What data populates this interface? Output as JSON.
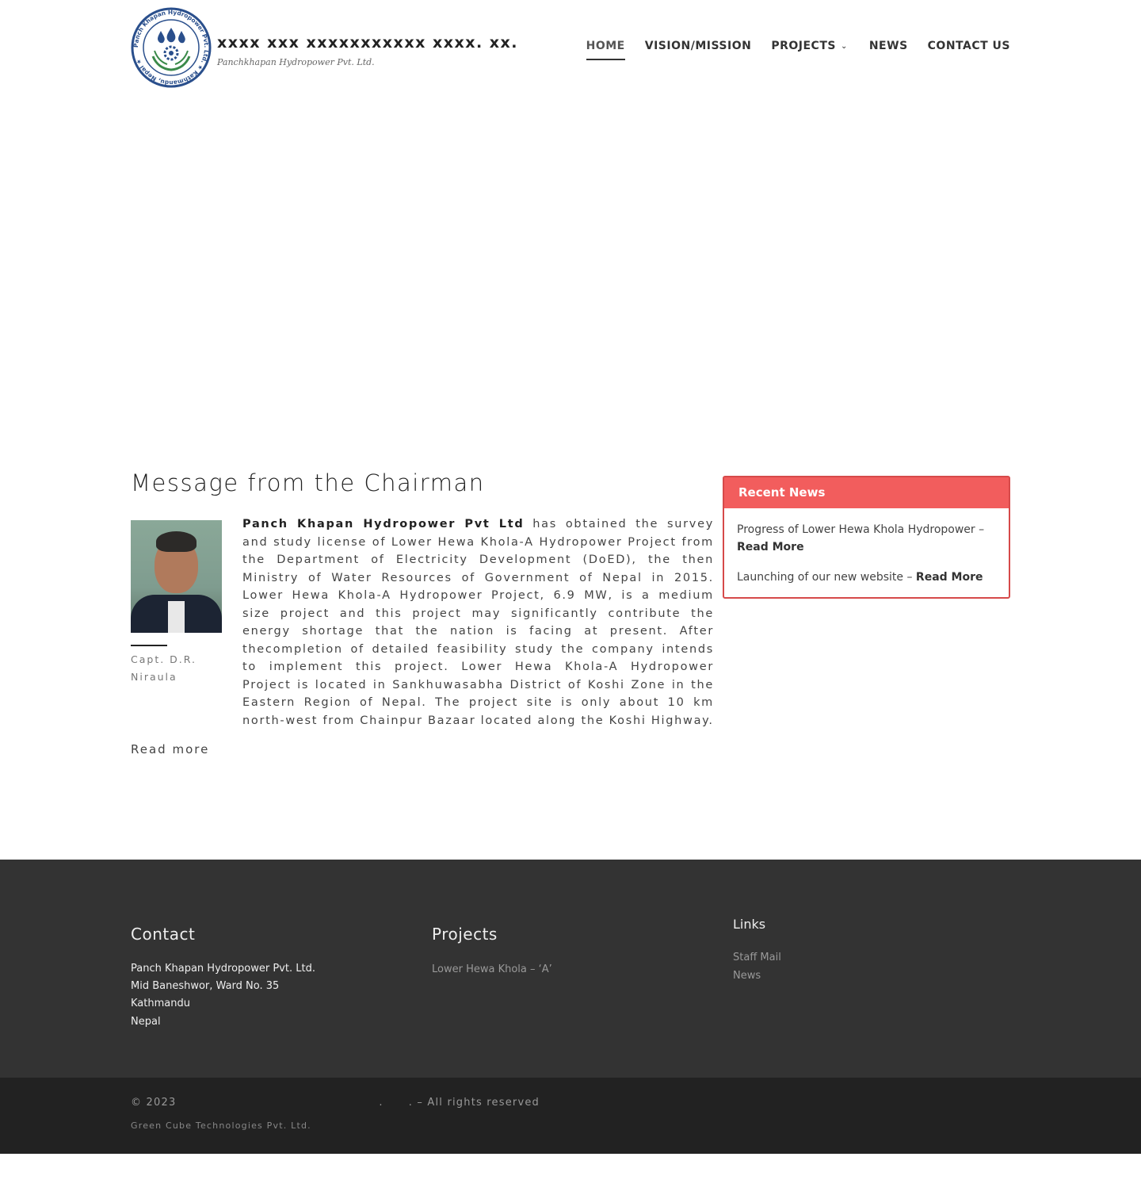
{
  "header": {
    "site_title": "xxxx xxx xxxxxxxxxxx xxxx. xx.",
    "tagline": "Panchkhapan Hydropower Pvt. Ltd.",
    "logo_text": "Panch Khapan Hydropower Pvt. Ltd. ★ Kathmandu, Nepal ★",
    "nav": [
      {
        "label": "HOME",
        "active": true
      },
      {
        "label": "VISION/MISSION"
      },
      {
        "label": "PROJECTS",
        "has_dropdown": true
      },
      {
        "label": "NEWS"
      },
      {
        "label": "CONTACT US"
      }
    ]
  },
  "chairman": {
    "heading": "Message from the Chairman",
    "name": "Capt. D.R. Niraula",
    "company_bold": "Panch Khapan Hydropower Pvt Ltd",
    "message": " has obtained the survey and study license of Lower Hewa Khola-A Hydropower Project from the Department of Electricity Development (DoED), the then Ministry of Water Resources of Government of Nepal in 2015.  Lower Hewa Khola-A Hydropower Project, 6.9 MW, is a medium size project and this project may significantly contribute the energy shortage that the nation is facing at present. After thecompletion of detailed feasibility study the company intends to implement this project. Lower Hewa Khola-A Hydropower Project is located in Sankhuwasabha District of Koshi Zone in the Eastern Region of Nepal. The project site is only about 10 km north-west from Chainpur Bazaar located along the Koshi Highway.",
    "read_more": "Read more"
  },
  "recent_news": {
    "title": "Recent News",
    "items": [
      {
        "text": "Progress of Lower Hewa Khola Hydropower –",
        "link": "Read More"
      },
      {
        "text": "Launching of our new website –",
        "link": "Read More"
      }
    ]
  },
  "footer": {
    "contact": {
      "title": "Contact",
      "lines": [
        "Panch Khapan Hydropower Pvt. Ltd.",
        "Mid Baneshwor, Ward No. 35",
        "Kathmandu",
        "Nepal"
      ]
    },
    "projects": {
      "title": "Projects",
      "items": [
        "Lower Hewa Khola – ‘A’"
      ]
    },
    "links": {
      "title": "Links",
      "items": [
        "Staff Mail",
        "News"
      ]
    },
    "copyright": "© 2023                                                .      . – All rights reserved",
    "credit": "Green Cube Technologies Pvt. Ltd."
  },
  "colors": {
    "accent_red": "#f25d5d",
    "footer_bg": "#333333",
    "bottom_bar_bg": "#222222",
    "logo_blue": "#2a4f8c"
  }
}
